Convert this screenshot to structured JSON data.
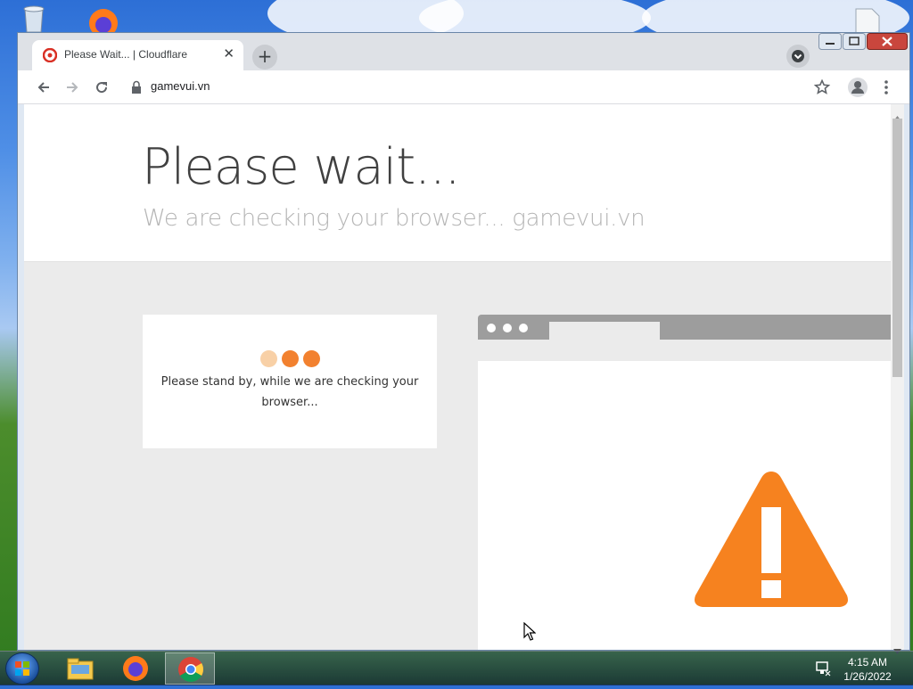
{
  "tab": {
    "title": "Please Wait... | Cloudflare",
    "close": "✕"
  },
  "newtab": {
    "label": "+"
  },
  "omnibox": {
    "url": "gamevui.vn"
  },
  "page": {
    "heading": "Please wait...",
    "subheading": "We are checking your browser... gamevui.vn",
    "card_text": "Please stand by, while we are checking your browser...",
    "dots": [
      "#f8d0a6",
      "#f2812f",
      "#f2812f"
    ]
  },
  "colors": {
    "accent": "#f6821f",
    "tab_bg": "#dee1e6",
    "page_bg": "#ebebeb"
  },
  "taskbar": {
    "time": "4:15 AM",
    "date": "1/26/2022",
    "apps": [
      "explorer-icon",
      "firefox-icon",
      "chrome-icon"
    ]
  },
  "desktop": {
    "icons": [
      "recycle-bin-icon",
      "firefox-shortcut-icon",
      "file-icon"
    ]
  }
}
